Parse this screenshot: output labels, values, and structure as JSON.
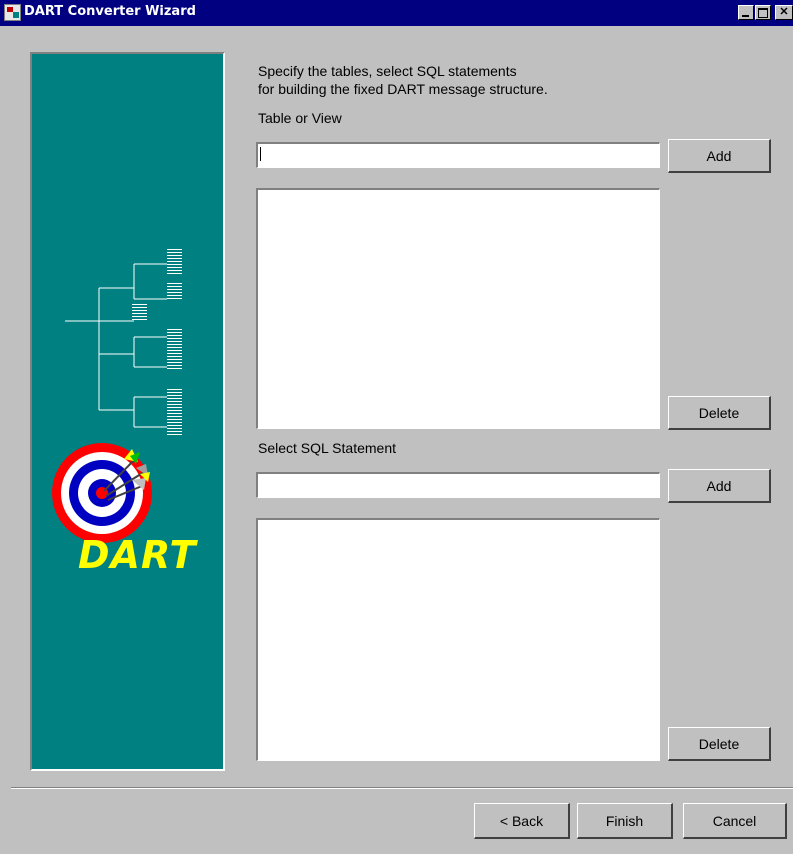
{
  "window": {
    "title": "DART Converter Wizard"
  },
  "logo": {
    "text": "DART"
  },
  "instructions": {
    "line1": "Specify the tables, select SQL statements",
    "line2": "for building the fixed DART message structure."
  },
  "table_section": {
    "label": "Table or View",
    "input_value": "",
    "add_label": "Add",
    "delete_label": "Delete",
    "items": []
  },
  "sql_section": {
    "label": "Select SQL Statement",
    "input_value": "",
    "add_label": "Add",
    "delete_label": "Delete",
    "items": []
  },
  "footer": {
    "back_label": "< Back",
    "finish_label": "Finish",
    "cancel_label": "Cancel"
  },
  "colors": {
    "title_bar": "#000080",
    "panel_background": "#008080",
    "window_background": "#c0c0c0",
    "logo_text": "#ffff00"
  }
}
